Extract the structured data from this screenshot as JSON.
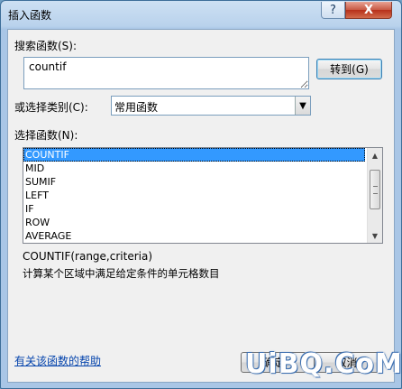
{
  "window": {
    "title": "插入函数",
    "help_glyph": "?",
    "close_glyph": "X"
  },
  "search": {
    "label": "搜索函数(S):",
    "value": "countif",
    "goto_label": "转到(G)"
  },
  "category": {
    "label": "或选择类别(C):",
    "selected": "常用函数",
    "arrow_glyph": "▼"
  },
  "functions": {
    "label": "选择函数(N):",
    "items": [
      "COUNTIF",
      "MID",
      "SUMIF",
      "LEFT",
      "IF",
      "ROW",
      "AVERAGE"
    ],
    "selected_index": 0
  },
  "scroll": {
    "up_glyph": "▲",
    "down_glyph": "▼"
  },
  "detail": {
    "syntax": "COUNTIF(range,criteria)",
    "description": "计算某个区域中满足给定条件的单元格数目"
  },
  "footer": {
    "help_link": "有关该函数的帮助",
    "ok_label": "确定",
    "cancel_label": "取消"
  },
  "watermark": "UiBQ.CoM",
  "colors": {
    "selection": "#3399ff",
    "title_gradient_top": "#cde0f3",
    "link": "#0645ad",
    "close_button": "#c75843"
  }
}
